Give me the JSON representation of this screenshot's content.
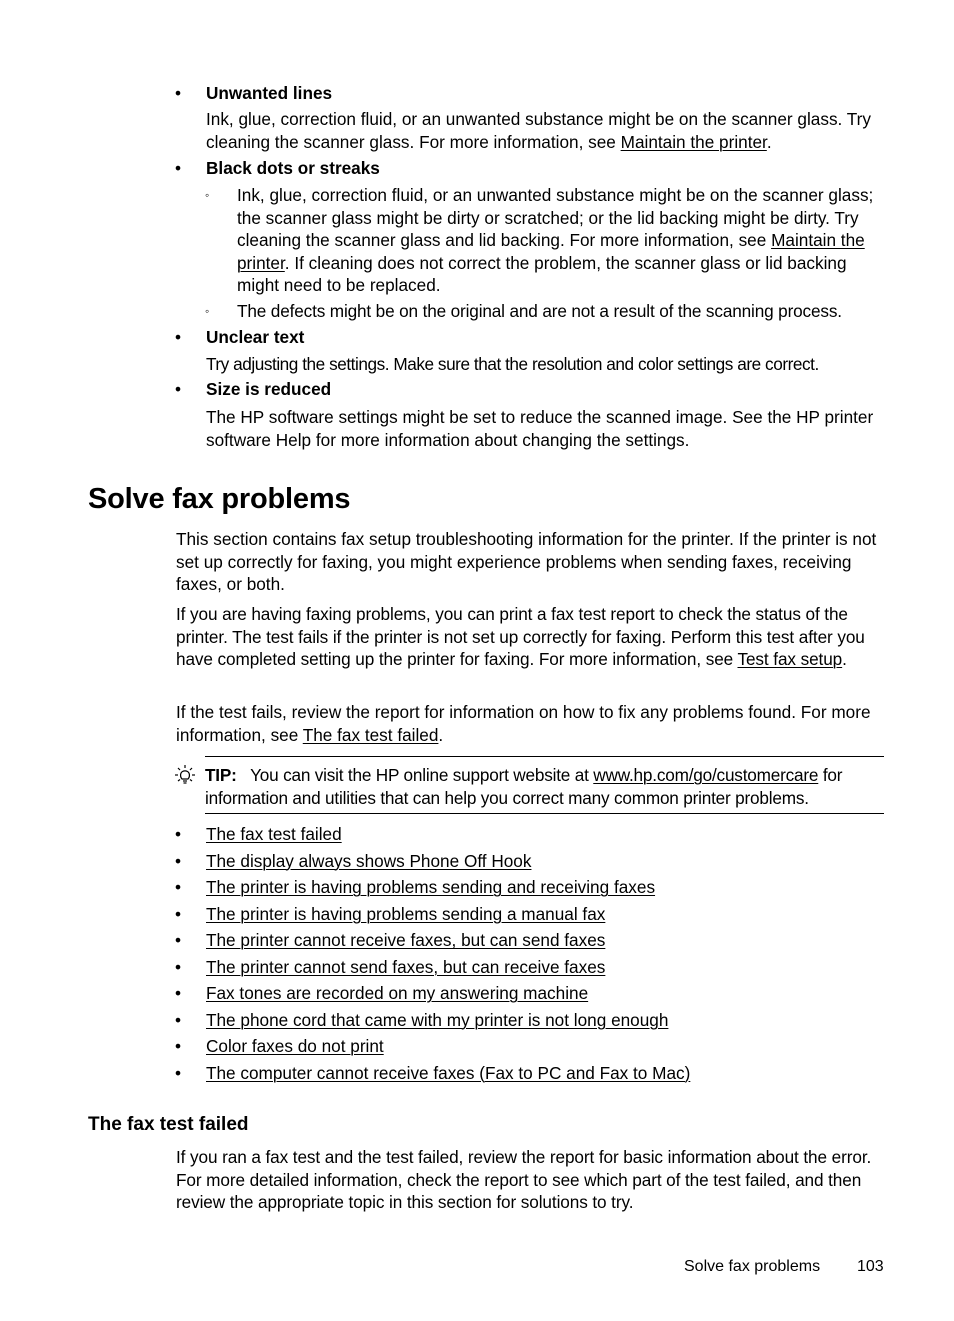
{
  "scan_issues": {
    "unwanted_lines": {
      "title": "Unwanted lines",
      "text_before": "Ink, glue, correction fluid, or an unwanted substance might be on the scanner glass. Try cleaning the scanner glass. For more information, see ",
      "link": "Maintain the printer",
      "text_after": "."
    },
    "black_dots": {
      "title": "Black dots or streaks",
      "sub1_before": "Ink, glue, correction fluid, or an unwanted substance might be on the scanner glass; the scanner glass might be dirty or scratched; or the lid backing might be dirty. Try cleaning the scanner glass and lid backing. For more information, see ",
      "sub1_link": "Maintain the printer",
      "sub1_after": ". If cleaning does not correct the problem, the scanner glass or lid backing might need to be replaced.",
      "sub2": "The defects might be on the original and are not a result of the scanning process."
    },
    "unclear_text": {
      "title": "Unclear text",
      "text": "Try adjusting the settings. Make sure that the resolution and color settings are correct."
    },
    "size_reduced": {
      "title": "Size is reduced",
      "text": "The HP software settings might be set to reduce the scanned image. See the HP printer software Help for more information about changing the settings."
    },
    "bullet": "•",
    "sub_bullet": "◦"
  },
  "section": {
    "title": "Solve fax problems",
    "para1": "This section contains fax setup troubleshooting information for the printer. If the printer is not set up correctly for faxing, you might experience problems when sending faxes, receiving faxes, or both.",
    "para2_before": "If you are having faxing problems, you can print a fax test report to check the status of the printer. The test fails if the printer is not set up correctly for faxing. Perform this test after you have completed setting up the printer for faxing. For more information, see ",
    "para2_link": "Test fax setup",
    "para2_after": ".",
    "para3_before": "If the test fails, review the report for information on how to fix any problems found. For more information, see ",
    "para3_link": "The fax test failed",
    "para3_after": ".",
    "tip": {
      "icon": "lightbulb-icon",
      "label": "TIP:",
      "text_before": "You can visit the HP online support website at ",
      "link": "www.hp.com/go/customercare",
      "text_after": " for information and utilities that can help you correct many common printer problems."
    },
    "links": [
      "The fax test failed",
      "The display always shows Phone Off Hook",
      "The printer is having problems sending and receiving faxes",
      "The printer is having problems sending a manual fax",
      "The printer cannot receive faxes, but can send faxes",
      "The printer cannot send faxes, but can receive faxes",
      "Fax tones are recorded on my answering machine",
      "The phone cord that came with my printer is not long enough",
      "Color faxes do not print",
      "The computer cannot receive faxes (Fax to PC and Fax to Mac)"
    ]
  },
  "subsection": {
    "title": "The fax test failed",
    "text": "If you ran a fax test and the test failed, review the report for basic information about the error. For more detailed information, check the report to see which part of the test failed, and then review the appropriate topic in this section for solutions to try."
  },
  "footer": {
    "section_name": "Solve fax problems",
    "page_number": "103"
  }
}
